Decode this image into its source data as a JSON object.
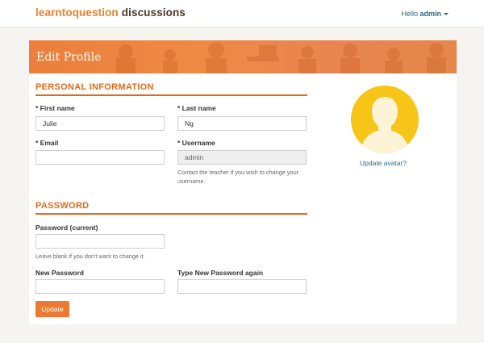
{
  "header": {
    "brand": "learntoquestion",
    "section": "discussions",
    "greeting": "Hello",
    "username": "admin"
  },
  "page": {
    "title": "Edit Profile"
  },
  "personal": {
    "heading": "PERSONAL INFORMATION",
    "first_name": {
      "label": "* First name",
      "value": "Julie"
    },
    "last_name": {
      "label": "* Last name",
      "value": "Ng"
    },
    "email": {
      "label": "* Email",
      "value": ""
    },
    "username": {
      "label": "* Username",
      "value": "admin",
      "help": "Contact the teacher if you wish to change your username."
    }
  },
  "password": {
    "heading": "PASSWORD",
    "current": {
      "label": "Password (current)",
      "value": "",
      "help": "Leave blank if you don't want to change it."
    },
    "new": {
      "label": "New Password",
      "value": ""
    },
    "confirm": {
      "label": "Type New Password again",
      "value": ""
    }
  },
  "actions": {
    "update_label": "Update"
  },
  "avatar": {
    "icon": "person-silhouette-icon",
    "update_link": "Update avatar?"
  },
  "colors": {
    "accent": "#e06a1c",
    "banner": "#ec7f3c",
    "avatar_bg": "#f7c518",
    "link": "#2a6a8a"
  }
}
